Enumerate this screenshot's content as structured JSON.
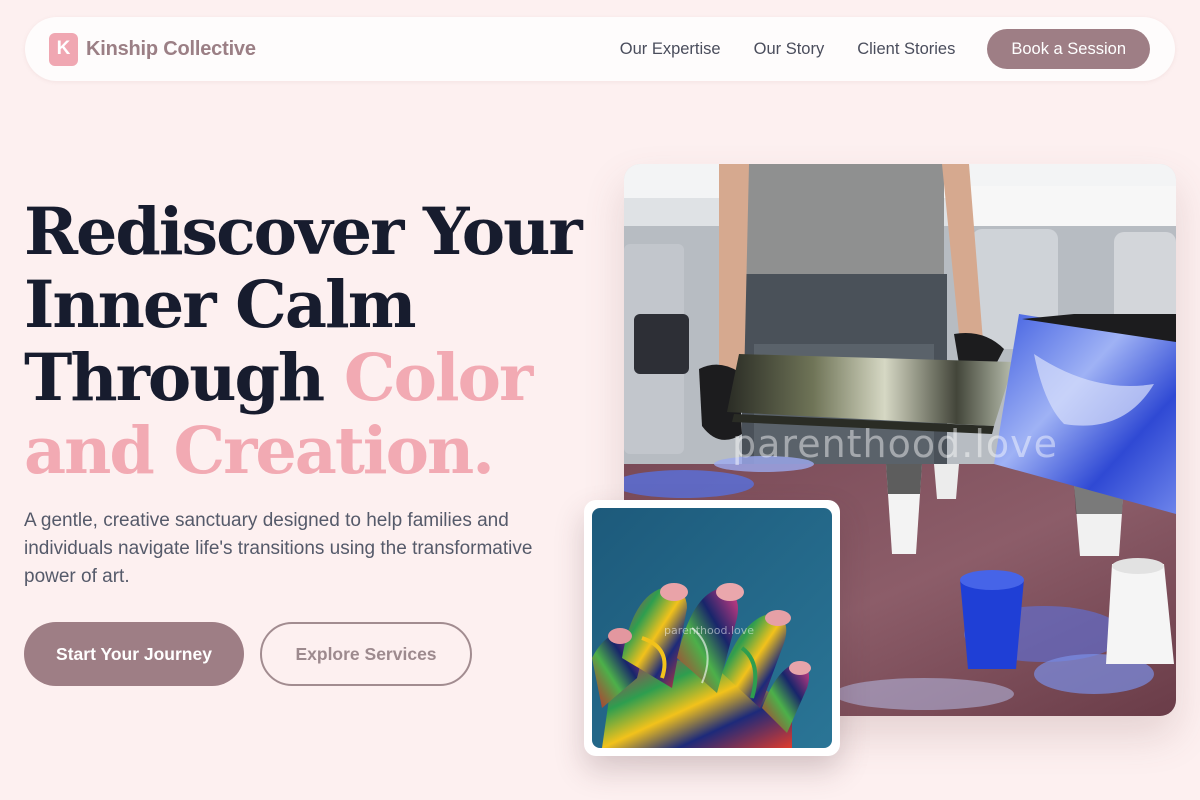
{
  "brand": {
    "logo_letter": "K",
    "name": "Kinship Collective"
  },
  "nav": {
    "links": [
      "Our Expertise",
      "Our Story",
      "Client Stories"
    ],
    "cta": "Book a Session"
  },
  "hero": {
    "headline_line1": "Rediscover Your",
    "headline_line2": "Inner Calm",
    "headline_line3_plain": "Through",
    "headline_line3_accent": "Color",
    "headline_line4_accent": "and Creation.",
    "subtext": "A gentle, creative sanctuary designed to help families and individuals navigate life's transitions using the transformative power of art.",
    "primary_cta": "Start Your Journey",
    "secondary_cta": "Explore Services"
  },
  "images": {
    "main_watermark": "parenthood.love",
    "small_watermark": "parenthood.love"
  },
  "colors": {
    "background": "#fdf0f0",
    "accent_pink": "#f2aab3",
    "button_mauve": "#9e7e85",
    "heading_navy": "#171c2e"
  }
}
